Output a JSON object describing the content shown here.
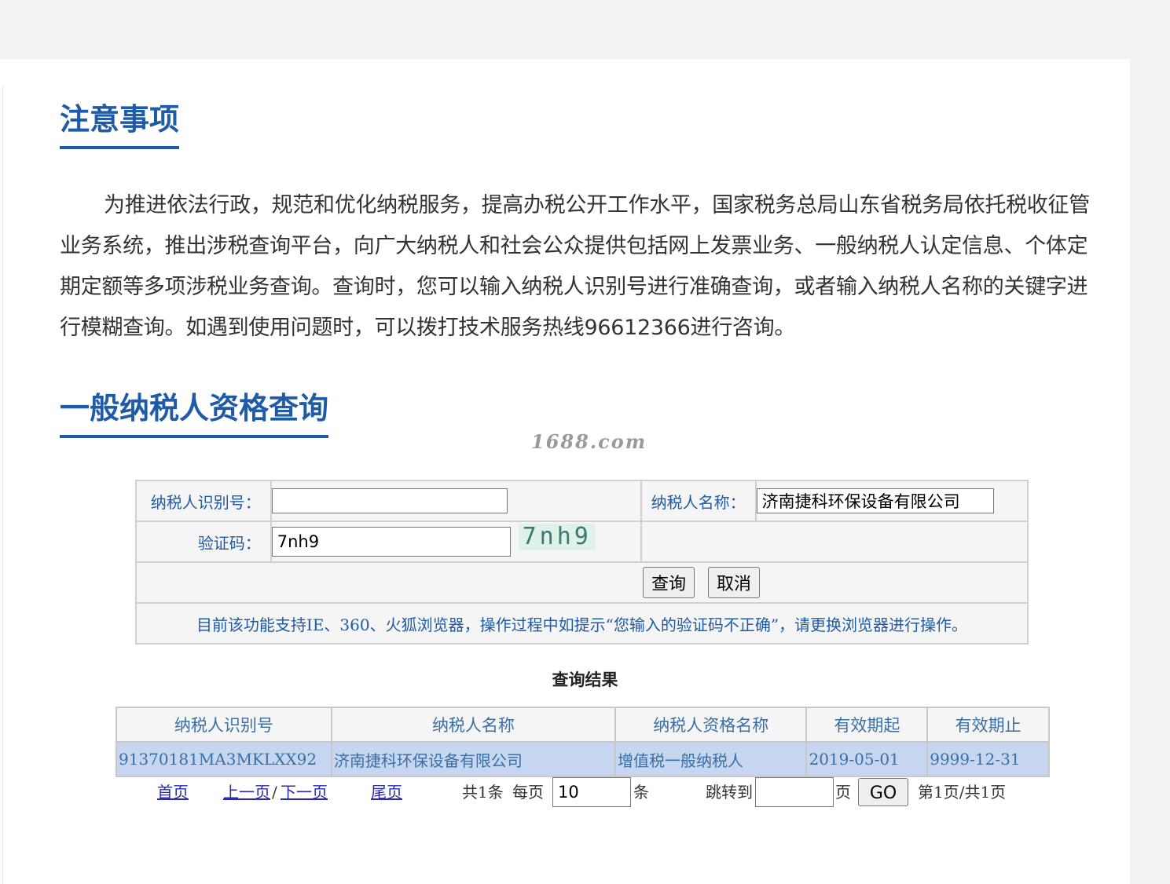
{
  "notice_section": {
    "title": "注意事项",
    "body": "为推进依法行政，规范和优化纳税服务，提高办税公开工作水平，国家税务总局山东省税务局依托税收征管业务系统，推出涉税查询平台，向广大纳税人和社会公众提供包括网上发票业务、一般纳税人认定信息、个体定期定额等多项涉税业务查询。查询时，您可以输入纳税人识别号进行准确查询，或者输入纳税人名称的关键字进行模糊查询。如遇到使用问题时，可以拨打技术服务热线96612366进行咨询。"
  },
  "query_section": {
    "title": "一般纳税人资格查询"
  },
  "watermark": "1688.com",
  "form": {
    "taxpayer_id_label": "纳税人识别号：",
    "taxpayer_id_value": "",
    "taxpayer_name_label": "纳税人名称：",
    "taxpayer_name_value": "济南捷科环保设备有限公司",
    "captcha_label": "验证码：",
    "captcha_value": "7nh9",
    "captcha_image_text": "7nh9",
    "query_button": "查询",
    "cancel_button": "取消",
    "browser_notice": "目前该功能支持IE、360、火狐浏览器，操作过程中如提示“您输入的验证码不正确”，请更换浏览器进行操作。"
  },
  "results": {
    "title": "查询结果",
    "columns": [
      "纳税人识别号",
      "纳税人名称",
      "纳税人资格名称",
      "有效期起",
      "有效期止"
    ],
    "rows": [
      [
        "91370181MA3MKLXX92",
        "济南捷科环保设备有限公司",
        "增值税一般纳税人",
        "2019-05-01",
        "9999-12-31"
      ]
    ]
  },
  "pager": {
    "first": "首页",
    "prev": "上一页",
    "separator": "/",
    "next": "下一页",
    "last": "尾页",
    "total": "共1条",
    "per_page_label": "每页",
    "per_page_value": "10",
    "per_page_unit": "条",
    "jump_label": "跳转到",
    "jump_value": "",
    "page_unit": "页",
    "go_button": "GO",
    "page_info": "第1页/共1页"
  },
  "colors": {
    "accent": "#1f5ba6",
    "row_highlight": "#c6d6f0",
    "page_bg": "#f2f2f2"
  }
}
